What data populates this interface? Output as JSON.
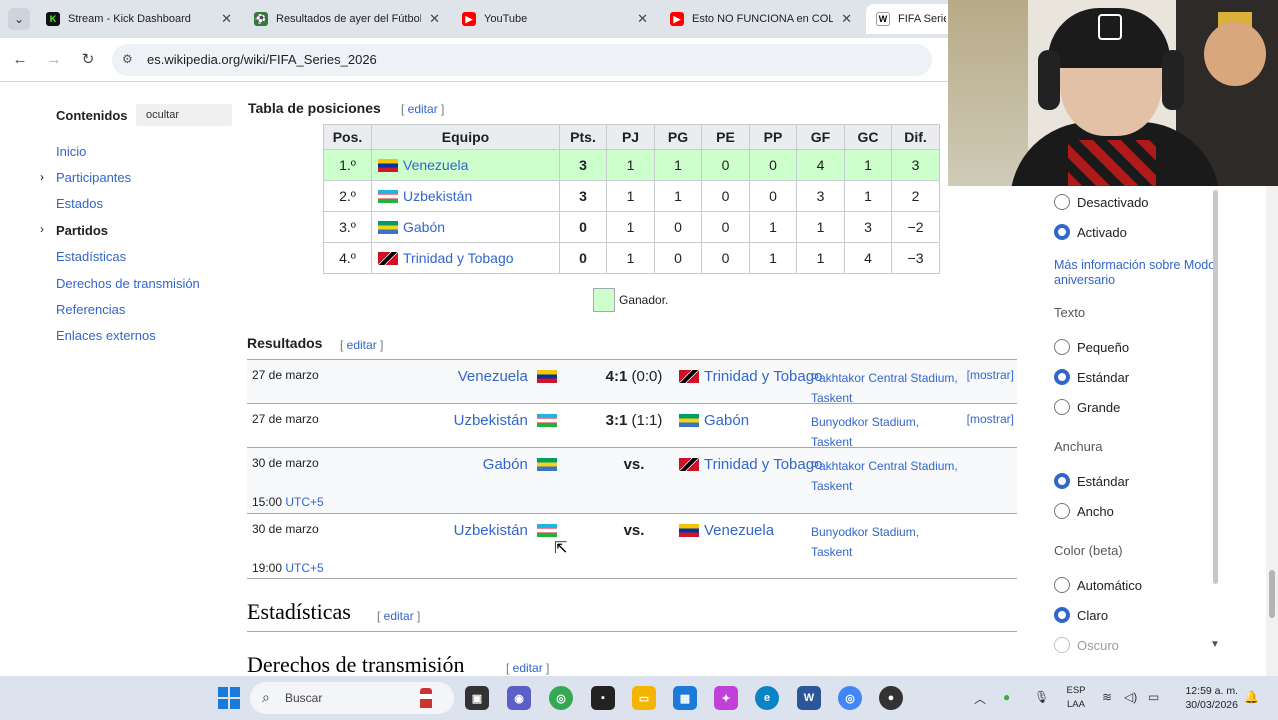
{
  "browser": {
    "tabs": [
      {
        "title": "Stream - Kick Dashboard",
        "icon": "kick-icon",
        "color": "#53fc18"
      },
      {
        "title": "Resultados de ayer del Fútbol",
        "icon": "soccer-icon",
        "color": "#2e7d32"
      },
      {
        "title": "YouTube",
        "icon": "youtube-icon",
        "color": "#ff0000"
      },
      {
        "title": "Esto NO FUNCIONA en COLOMBIA",
        "icon": "youtube-icon",
        "color": "#ff0000"
      },
      {
        "title": "FIFA Series",
        "icon": "wikipedia-icon",
        "color": "#ffffff"
      }
    ],
    "close_glyph": "✕",
    "url": "es.wikipedia.org/wiki/FIFA_Series_2026"
  },
  "toc": {
    "title": "Contenidos",
    "hide": "ocultar",
    "items": [
      "Inicio",
      "Participantes",
      "Estados",
      "Partidos",
      "Estadísticas",
      "Derechos de transmisión",
      "Referencias",
      "Enlaces externos"
    ]
  },
  "standings": {
    "title": "Tabla de posiciones",
    "edit": "editar",
    "headers": [
      "Pos.",
      "Equipo",
      "Pts.",
      "PJ",
      "PG",
      "PE",
      "PP",
      "GF",
      "GC",
      "Dif."
    ],
    "rows": [
      {
        "pos": "1.º",
        "team": "Venezuela",
        "flag": "ven",
        "pts": "3",
        "pj": "1",
        "pg": "1",
        "pe": "0",
        "pp": "0",
        "gf": "4",
        "gc": "1",
        "dif": "3"
      },
      {
        "pos": "2.º",
        "team": "Uzbekistán",
        "flag": "uzb",
        "pts": "3",
        "pj": "1",
        "pg": "1",
        "pe": "0",
        "pp": "0",
        "gf": "3",
        "gc": "1",
        "dif": "2"
      },
      {
        "pos": "3.º",
        "team": "Gabón",
        "flag": "gab",
        "pts": "0",
        "pj": "1",
        "pg": "0",
        "pe": "0",
        "pp": "1",
        "gf": "1",
        "gc": "3",
        "dif": "−2"
      },
      {
        "pos": "4.º",
        "team": "Trinidad y Tobago",
        "flag": "tto",
        "pts": "0",
        "pj": "1",
        "pg": "0",
        "pe": "0",
        "pp": "1",
        "gf": "1",
        "gc": "4",
        "dif": "−3"
      }
    ],
    "legend": "Ganador."
  },
  "results": {
    "title": "Resultados",
    "edit": "editar",
    "matches": [
      {
        "date": "27 de marzo",
        "home": "Venezuela",
        "home_flag": "ven",
        "score": "4:1",
        "half": "(0:0)",
        "away": "Trinidad y Tobago",
        "away_flag": "tto",
        "venue": "Pakhtakor Central Stadium,",
        "city": "Taskent",
        "mostrar": "[mostrar]",
        "time": "",
        "tz": ""
      },
      {
        "date": "27 de marzo",
        "home": "Uzbekistán",
        "home_flag": "uzb",
        "score": "3:1",
        "half": "(1:1)",
        "away": "Gabón",
        "away_flag": "gab",
        "venue": "Bunyodkor Stadium,",
        "city": "Taskent",
        "mostrar": "[mostrar]",
        "time": "",
        "tz": ""
      },
      {
        "date": "30 de marzo",
        "home": "Gabón",
        "home_flag": "gab",
        "score": "vs.",
        "half": "",
        "away": "Trinidad y Tobago",
        "away_flag": "tto",
        "venue": "Pakhtakor Central Stadium,",
        "city": "Taskent",
        "mostrar": "",
        "time": "15:00",
        "tz": "UTC+5"
      },
      {
        "date": "30 de marzo",
        "home": "Uzbekistán",
        "home_flag": "uzb",
        "score": "vs.",
        "half": "",
        "away": "Venezuela",
        "away_flag": "ven",
        "venue": "Bunyodkor Stadium,",
        "city": "Taskent",
        "mostrar": "",
        "time": "19:00",
        "tz": "UTC+5"
      }
    ]
  },
  "sections": {
    "stats": "Estadísticas",
    "broadcast": "Derechos de transmisión",
    "edit": "editar"
  },
  "appearance": {
    "anniversary": {
      "off": "Desactivado",
      "on": "Activado",
      "selected": "on"
    },
    "more_info": "Más información sobre Modo aniversario",
    "text_label": "Texto",
    "text_options": [
      "Pequeño",
      "Estándar",
      "Grande"
    ],
    "text_selected": 1,
    "width_label": "Anchura",
    "width_options": [
      "Estándar",
      "Ancho"
    ],
    "width_selected": 0,
    "color_label": "Color (beta)",
    "color_options": [
      "Automático",
      "Claro",
      "Oscuro"
    ],
    "color_selected": 1
  },
  "taskbar": {
    "search_placeholder": "Buscar",
    "lang_top": "ESP",
    "lang_bottom": "LAA",
    "time": "12:59 a. m.",
    "date": "30/03/2026"
  },
  "colors": {
    "link": "#3366cc",
    "winner": "#ccffcc",
    "table_header": "#eaecf0"
  }
}
